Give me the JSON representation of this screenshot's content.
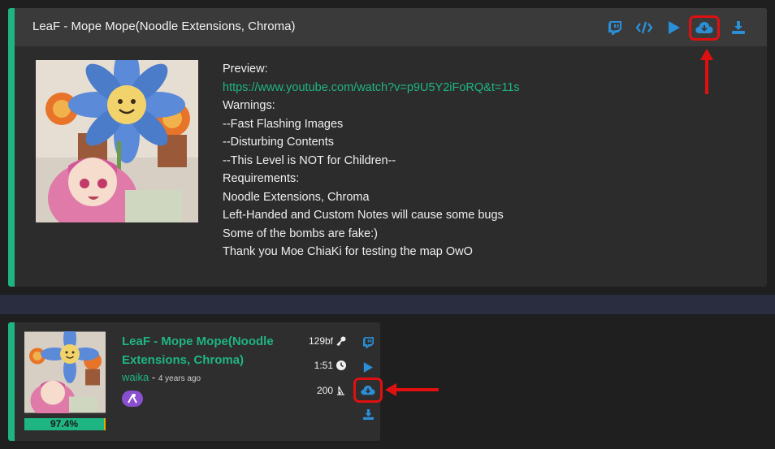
{
  "top": {
    "title": "LeaF - Mope Mope(Noodle Extensions, Chroma)",
    "icons": [
      "twitch-icon",
      "code-icon",
      "play-icon",
      "cloud-download-icon",
      "download-icon"
    ],
    "description": {
      "preview_label": "Preview:",
      "preview_url": "https://www.youtube.com/watch?v=p9U5Y2iFoRQ&t=11s",
      "lines": [
        "Warnings:",
        "--Fast Flashing Images",
        "--Disturbing Contents",
        "--This Level is NOT for Children--",
        "Requirements:",
        "Noodle Extensions, Chroma",
        "Left-Handed and Custom Notes will cause some bugs",
        "Some of the bombs are fake:)",
        "Thank you Moe ChiaKi for testing the map OwO"
      ]
    }
  },
  "bottom": {
    "title": "LeaF - Mope Mope(Noodle Extensions, Chroma)",
    "mapper": "waika",
    "separator": " - ",
    "ago": "4 years ago",
    "rating": "97.4%",
    "stats": {
      "key": "129bf",
      "duration": "1:51",
      "notes": "200"
    }
  },
  "colors": {
    "accent": "#1fb583",
    "icon_blue": "#2a8fd6",
    "highlight_red": "#e01010"
  }
}
